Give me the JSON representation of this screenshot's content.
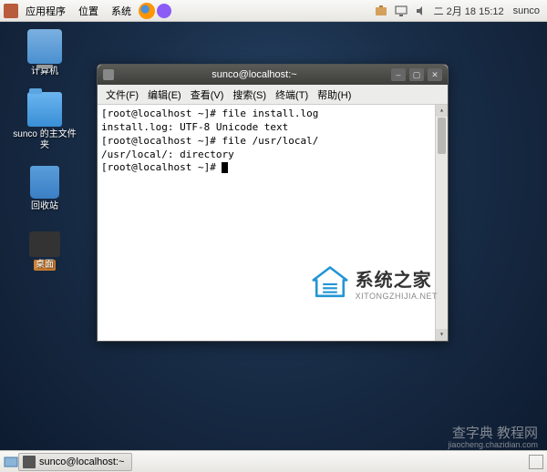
{
  "panel": {
    "menu_apps": "应用程序",
    "menu_places": "位置",
    "menu_system": "系统",
    "clock": "二 2月 18 15:12",
    "user": "sunco"
  },
  "desktop": {
    "computer": "计算机",
    "home_folder": "sunco 的主文件夹",
    "trash": "回收站",
    "tweaks": "桌面"
  },
  "terminal": {
    "title": "sunco@localhost:~",
    "menu": {
      "file": "文件(F)",
      "edit": "编辑(E)",
      "view": "查看(V)",
      "search": "搜索(S)",
      "terminal": "终端(T)",
      "help": "帮助(H)"
    },
    "lines": {
      "l1": "[root@localhost ~]# file install.log",
      "l2": "install.log: UTF-8 Unicode text",
      "l3": "[root@localhost ~]# file /usr/local/",
      "l4": "/usr/local/: directory",
      "l5": "[root@localhost ~]# "
    }
  },
  "watermark": {
    "main": "系统之家",
    "sub": "XITONGZHIJIA.NET"
  },
  "watermark2": {
    "main": "查字典  教程网",
    "sub": "jiaocheng.chazidian.com"
  },
  "bottom": {
    "task1": "sunco@localhost:~"
  }
}
